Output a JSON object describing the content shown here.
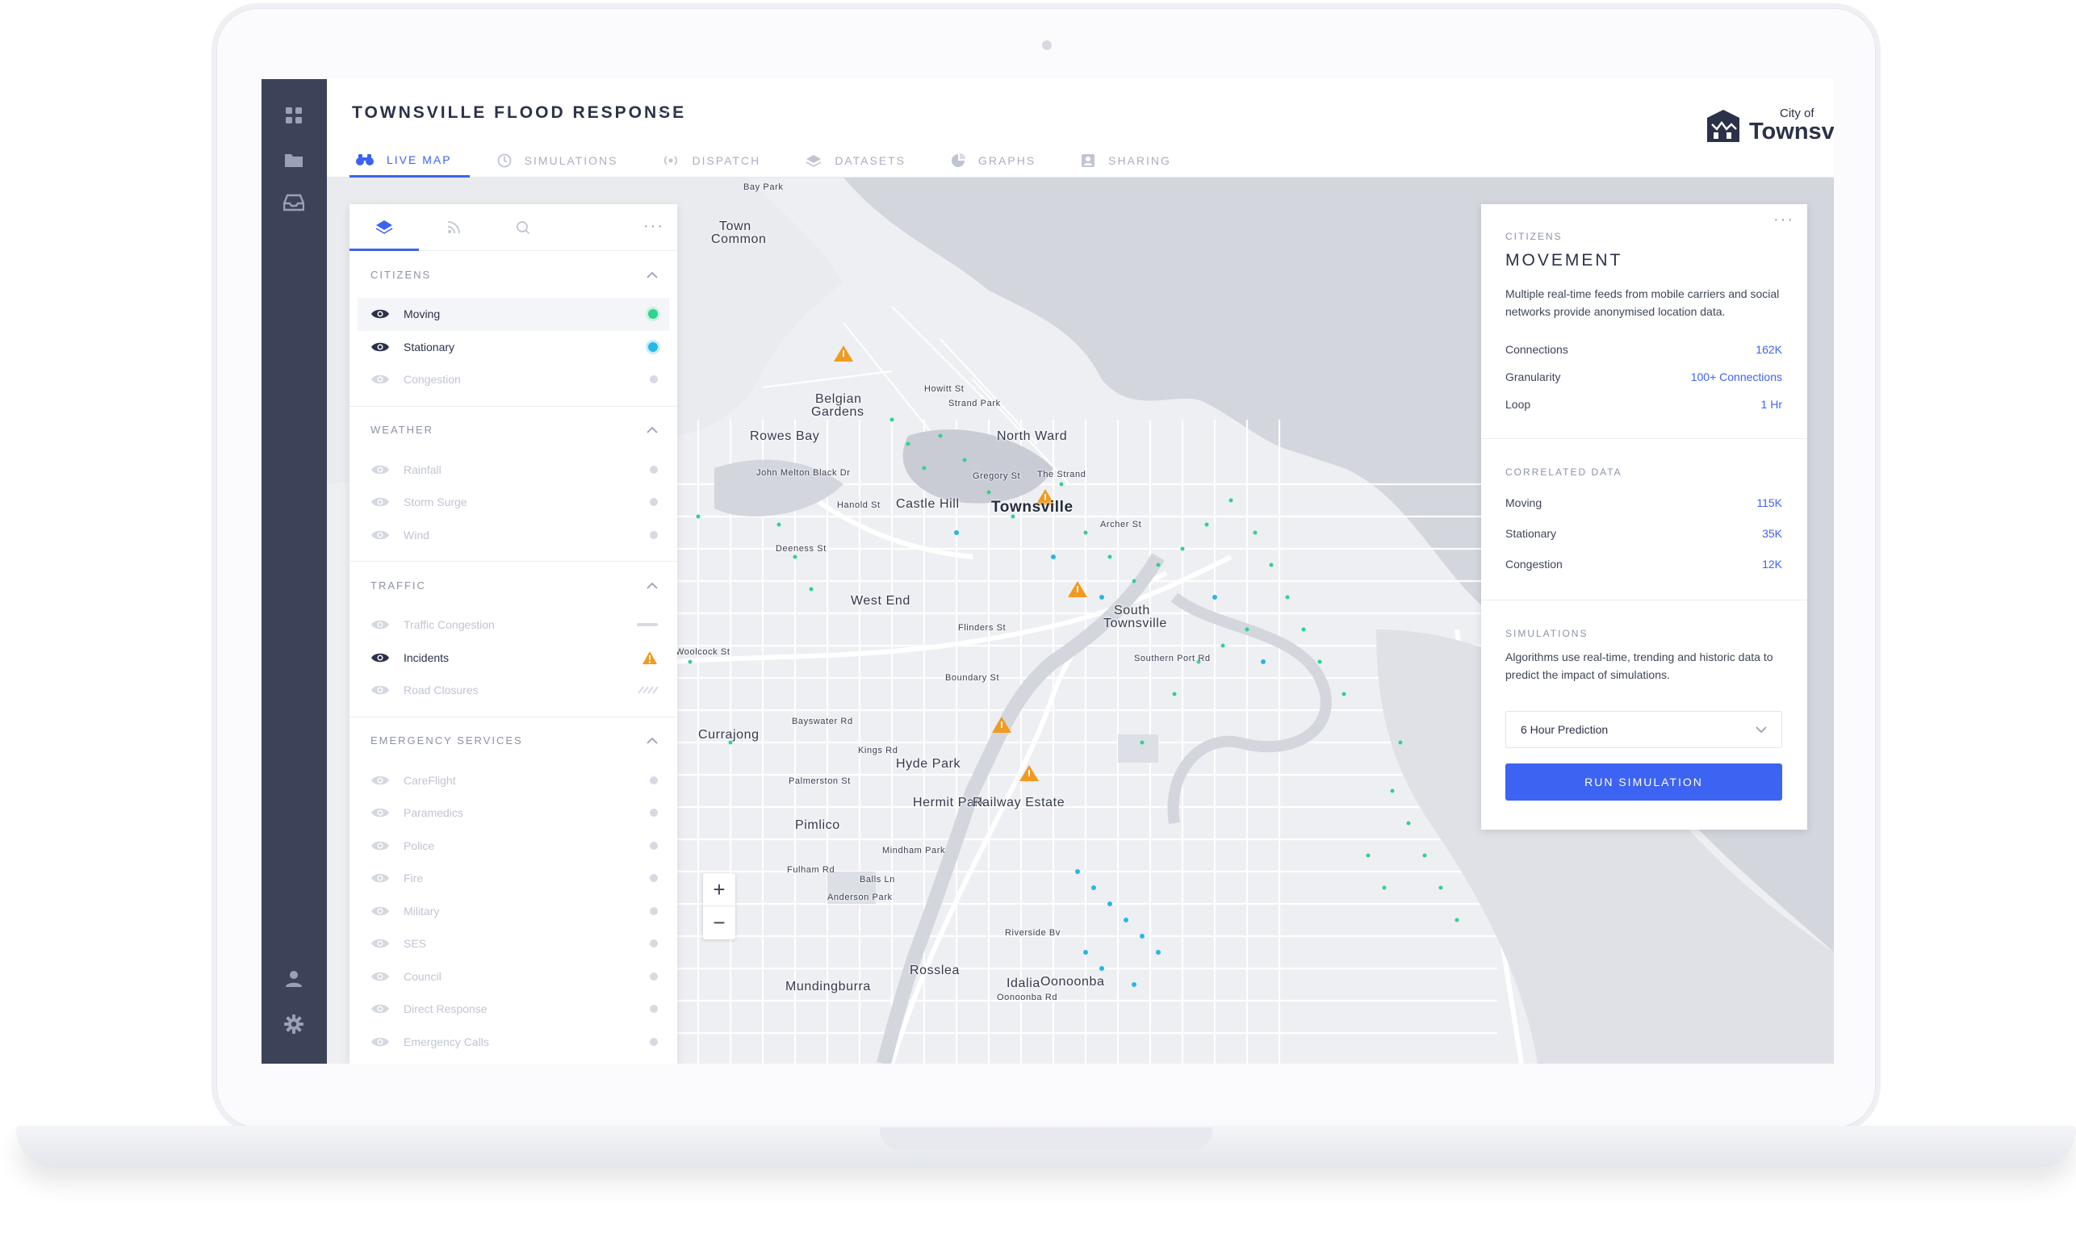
{
  "app": {
    "title": "TOWNSVILLE FLOOD RESPONSE",
    "more": "···"
  },
  "tabs": [
    {
      "label": "LIVE MAP",
      "icon": "binoculars-icon",
      "active": true
    },
    {
      "label": "SIMULATIONS",
      "icon": "clock-icon"
    },
    {
      "label": "DISPATCH",
      "icon": "broadcast-icon"
    },
    {
      "label": "DATASETS",
      "icon": "layers-icon"
    },
    {
      "label": "GRAPHS",
      "icon": "pie-chart-icon"
    },
    {
      "label": "SHARING",
      "icon": "user-card-icon"
    }
  ],
  "logo": {
    "small": "City of",
    "big": "Townsville"
  },
  "colors": {
    "accent": "#3d63f2",
    "rail": "#3c4257",
    "moving": "#2fd38f",
    "stationary": "#27b7e4",
    "incident": "#f29a1f"
  },
  "layer_panel": {
    "more": "···",
    "tabs": [
      "layers-icon",
      "feed-icon",
      "search-icon"
    ],
    "sections": [
      {
        "title": "CITIZENS",
        "items": [
          {
            "label": "Moving",
            "visible": true,
            "marker": "green-dot",
            "highlighted": true
          },
          {
            "label": "Stationary",
            "visible": true,
            "marker": "blue-dot"
          },
          {
            "label": "Congestion",
            "visible": false,
            "marker": "grey-dot"
          }
        ]
      },
      {
        "title": "WEATHER",
        "items": [
          {
            "label": "Rainfall",
            "visible": false,
            "marker": "grey-dot"
          },
          {
            "label": "Storm Surge",
            "visible": false,
            "marker": "grey-dot"
          },
          {
            "label": "Wind",
            "visible": false,
            "marker": "grey-dot"
          }
        ]
      },
      {
        "title": "TRAFFIC",
        "items": [
          {
            "label": "Traffic Congestion",
            "visible": false,
            "marker": "line"
          },
          {
            "label": "Incidents",
            "visible": true,
            "marker": "warning"
          },
          {
            "label": "Road Closures",
            "visible": false,
            "marker": "hatch"
          }
        ]
      },
      {
        "title": "EMERGENCY SERVICES",
        "items": [
          {
            "label": "CareFlight",
            "visible": false,
            "marker": "grey-dot"
          },
          {
            "label": "Paramedics",
            "visible": false,
            "marker": "grey-dot"
          },
          {
            "label": "Police",
            "visible": false,
            "marker": "grey-dot"
          },
          {
            "label": "Fire",
            "visible": false,
            "marker": "grey-dot"
          },
          {
            "label": "Military",
            "visible": false,
            "marker": "grey-dot"
          },
          {
            "label": "SES",
            "visible": false,
            "marker": "grey-dot"
          },
          {
            "label": "Council",
            "visible": false,
            "marker": "grey-dot"
          },
          {
            "label": "Direct Response",
            "visible": false,
            "marker": "grey-dot"
          },
          {
            "label": "Emergency Calls",
            "visible": false,
            "marker": "grey-dot"
          }
        ]
      }
    ]
  },
  "info_card": {
    "more": "···",
    "category": "CITIZENS",
    "title": "MOVEMENT",
    "description": "Multiple real-time feeds from mobile carriers and social networks provide anonymised location data.",
    "stats": [
      {
        "label": "Connections",
        "value": "162K"
      },
      {
        "label": "Granularity",
        "value": "100+ Connections"
      },
      {
        "label": "Loop",
        "value": "1 Hr"
      }
    ],
    "correlated_title": "CORRELATED DATA",
    "correlated": [
      {
        "label": "Moving",
        "value": "115K"
      },
      {
        "label": "Stationary",
        "value": "35K"
      },
      {
        "label": "Congestion",
        "value": "12K"
      }
    ],
    "simulations_title": "SIMULATIONS",
    "simulations_desc": "Algorithms use real-time, trending and historic data to predict the impact of simulations.",
    "select_value": "6 Hour Prediction",
    "run_label": "RUN SIMULATION"
  },
  "map": {
    "zoom_in": "+",
    "zoom_out": "−",
    "labels": [
      {
        "text": "Bay Park",
        "type": "normal"
      },
      {
        "text": "Town",
        "type": "normal"
      },
      {
        "text": "Common",
        "type": "normal"
      },
      {
        "text": "Belgian",
        "type": "normal"
      },
      {
        "text": "Gardens",
        "type": "normal"
      },
      {
        "text": "Rowes Bay",
        "type": "normal"
      },
      {
        "text": "North Ward",
        "type": "normal"
      },
      {
        "text": "Strand Park",
        "type": "street"
      },
      {
        "text": "Castle Hill",
        "type": "normal"
      },
      {
        "text": "Townsville",
        "type": "big"
      },
      {
        "text": "West End",
        "type": "normal"
      },
      {
        "text": "South",
        "type": "normal"
      },
      {
        "text": "Townsville",
        "type": "normal"
      },
      {
        "text": "Currajong",
        "type": "normal"
      },
      {
        "text": "Hyde Park",
        "type": "normal"
      },
      {
        "text": "Hermit Park",
        "type": "normal"
      },
      {
        "text": "Railway Estate",
        "type": "normal"
      },
      {
        "text": "Pimlico",
        "type": "normal"
      },
      {
        "text": "Mindham Park",
        "type": "street"
      },
      {
        "text": "Anderson Park",
        "type": "street"
      },
      {
        "text": "Rosslea",
        "type": "normal"
      },
      {
        "text": "Mundingburra",
        "type": "normal"
      },
      {
        "text": "Idalia",
        "type": "normal"
      },
      {
        "text": "Oonoonba",
        "type": "normal"
      },
      {
        "text": "Woolcock St",
        "type": "street"
      },
      {
        "text": "Bayswater Rd",
        "type": "street"
      },
      {
        "text": "Palmerston St",
        "type": "street"
      },
      {
        "text": "Fulham Rd",
        "type": "street"
      },
      {
        "text": "Boundary St",
        "type": "street"
      },
      {
        "text": "Flinders St",
        "type": "street"
      },
      {
        "text": "The Strand",
        "type": "street"
      },
      {
        "text": "Southern Port Rd",
        "type": "street"
      },
      {
        "text": "Deeness St",
        "type": "street"
      },
      {
        "text": "John Melton Black Dr",
        "type": "street"
      },
      {
        "text": "Howitt St",
        "type": "street"
      },
      {
        "text": "Gregory St",
        "type": "street"
      },
      {
        "text": "Archer St",
        "type": "street"
      },
      {
        "text": "Hanold St",
        "type": "street"
      },
      {
        "text": "Kings Rd",
        "type": "street"
      },
      {
        "text": "Balls Ln",
        "type": "street"
      },
      {
        "text": "Riverside Bv",
        "type": "street"
      },
      {
        "text": "Oonoonba Rd",
        "type": "street"
      }
    ]
  }
}
